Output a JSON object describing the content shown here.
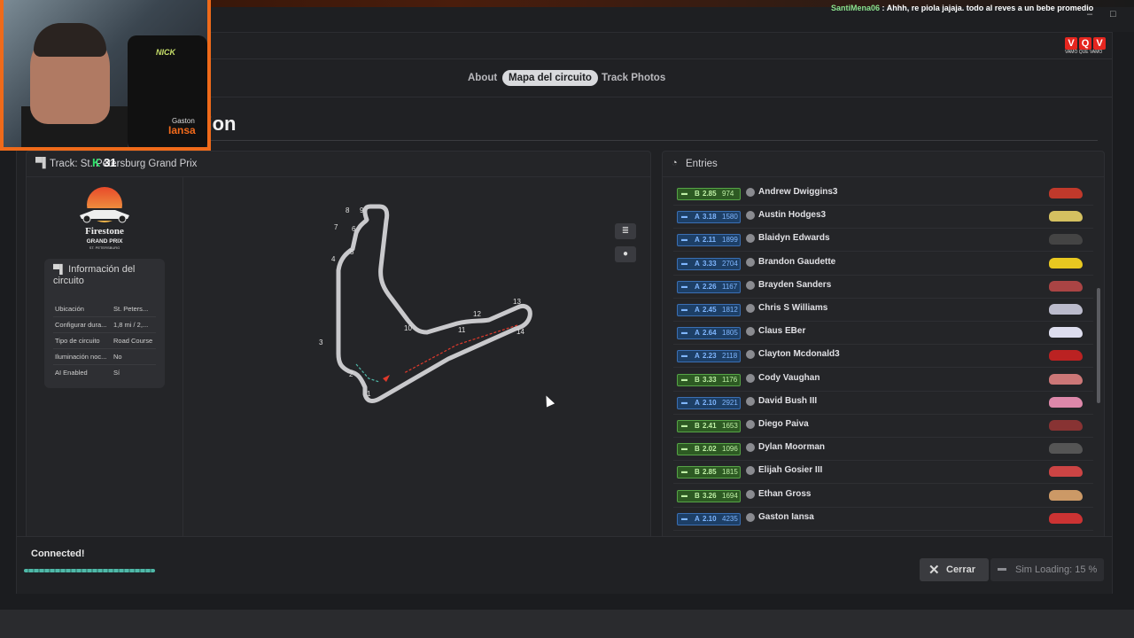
{
  "chat": {
    "user": "SantiMena06",
    "message": ": Ahhh, re piola jajaja. todo al reves a un bebe promedio"
  },
  "tabs": [
    {
      "label": "About",
      "active": false
    },
    {
      "label": "Mapa del circuito",
      "active": true
    },
    {
      "label": "Track Photos",
      "active": false
    }
  ],
  "heading": "ssion",
  "track_panel": {
    "title": "Track: St. Petersburg Grand Prix",
    "logo": {
      "line1": "Firestone",
      "line2": "GRAND PRIX",
      "line3": "ST. PETERSBURG"
    },
    "info": {
      "title": "Información del circuito",
      "rows": [
        {
          "k": "Ubicación",
          "v": "St. Peters..."
        },
        {
          "k": "Configurar dura...",
          "v": "1,8 mi / 2,..."
        },
        {
          "k": "Tipo de circuito",
          "v": "Road Course"
        },
        {
          "k": "Iluminación noc...",
          "v": "No"
        },
        {
          "k": "AI Enabled",
          "v": "Sí"
        }
      ]
    },
    "turns": [
      "1",
      "2",
      "3",
      "4",
      "5",
      "6",
      "7",
      "8",
      "9",
      "10",
      "11",
      "12",
      "13",
      "14"
    ]
  },
  "entries": {
    "title": "Entries",
    "rows": [
      {
        "lic": "B",
        "sr": "2.85",
        "ir": "974",
        "name": "Andrew Dwiggins3",
        "car": "#c0392b"
      },
      {
        "lic": "A",
        "sr": "3.18",
        "ir": "1580",
        "name": "Austin Hodges3",
        "car": "#d4c060"
      },
      {
        "lic": "A",
        "sr": "2.11",
        "ir": "1899",
        "name": "Blaidyn Edwards",
        "car": "#444"
      },
      {
        "lic": "A",
        "sr": "3.33",
        "ir": "2704",
        "name": "Brandon Gaudette",
        "car": "#e8c820"
      },
      {
        "lic": "A",
        "sr": "2.26",
        "ir": "1167",
        "name": "Brayden Sanders",
        "car": "#a44"
      },
      {
        "lic": "A",
        "sr": "2.45",
        "ir": "1812",
        "name": "Chris S Williams",
        "car": "#bbc"
      },
      {
        "lic": "A",
        "sr": "2.64",
        "ir": "1805",
        "name": "Claus EBer",
        "car": "#dde"
      },
      {
        "lic": "A",
        "sr": "2.23",
        "ir": "2118",
        "name": "Clayton Mcdonald3",
        "car": "#b22"
      },
      {
        "lic": "B",
        "sr": "3.33",
        "ir": "1176",
        "name": "Cody Vaughan",
        "car": "#c77"
      },
      {
        "lic": "A",
        "sr": "2.10",
        "ir": "2921",
        "name": "David Bush III",
        "car": "#d8a"
      },
      {
        "lic": "B",
        "sr": "2.41",
        "ir": "1653",
        "name": "Diego Paiva",
        "car": "#833"
      },
      {
        "lic": "B",
        "sr": "2.02",
        "ir": "1096",
        "name": "Dylan Moorman",
        "car": "#555"
      },
      {
        "lic": "B",
        "sr": "2.85",
        "ir": "1815",
        "name": "Elijah Gosier III",
        "car": "#c44"
      },
      {
        "lic": "B",
        "sr": "3.26",
        "ir": "1694",
        "name": "Ethan Gross",
        "car": "#c96"
      },
      {
        "lic": "A",
        "sr": "2.10",
        "ir": "4235",
        "name": "Gaston Iansa",
        "car": "#c33"
      }
    ]
  },
  "footer": {
    "status": "Connected!",
    "close_label": "Cerrar",
    "sim_loading": "Sim Loading: 15 %"
  },
  "overlay": {
    "channel_number": "31",
    "brand_name": "Gaston",
    "brand_word": "Iansa",
    "chair_brand": "NICK",
    "vqv": {
      "letters": [
        "V",
        "Q",
        "V"
      ],
      "sub": "VAMO QUE VAMO"
    }
  },
  "colors": {
    "accent_orange": "#ef6a1a",
    "license_a": "#3a6fb3",
    "license_b": "#56a446",
    "progress": "#4fb8a8"
  }
}
